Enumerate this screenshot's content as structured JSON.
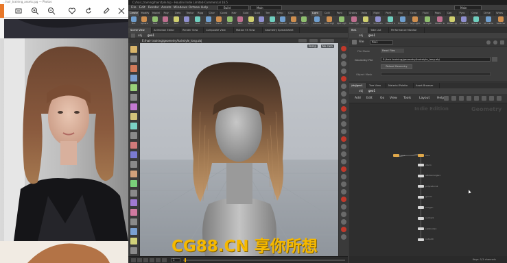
{
  "viewer": {
    "title": "…hair_training_assets.jpg — Photos",
    "toolbar_icons": [
      "tab-icon",
      "fit-icon",
      "zoom-in-icon",
      "zoom-out-icon",
      "favorite-icon",
      "rotate-icon",
      "edit-icon",
      "settings-icon"
    ]
  },
  "houdini": {
    "title": "C:/hair_training/hairstyle.hip - Houdini Indie Limited-Commercial 16.5",
    "menu": [
      "File",
      "Edit",
      "Render",
      "Assets",
      "Windows",
      "Octane",
      "Help"
    ],
    "build_label": "Build",
    "main_label": "Main",
    "main_label_right": "Main",
    "shelf_tabs_left": [
      "Create",
      "Modify",
      "Model",
      "Poly",
      "Defo",
      "Textur",
      "Rigg",
      "Char",
      "Const",
      "Hair",
      "Guid",
      "Guid",
      "Terr",
      "Simp",
      "Clou",
      "Vol"
    ],
    "shelf_tabs_right": [
      "Light",
      "Colli",
      "Parti",
      "Grains",
      "Vella",
      "Rigid",
      "Parti",
      "Visc",
      "Ocea",
      "Fluid",
      "Popu",
      "Con",
      "Pyro",
      "Crow",
      "Drive",
      "Wires"
    ],
    "tools_left": [
      "Box",
      "Sphere",
      "Tube",
      "Torus",
      "Grid",
      "Null",
      "Line",
      "Circle",
      "Curve",
      "Draw",
      "Path",
      "Spray",
      "Font",
      "L-System",
      "Platonic",
      "Metaball",
      "Object"
    ],
    "tools_right": [
      "Camera",
      "Point Light",
      "Spot Light",
      "Area Light",
      "Geometry Light",
      "Volume Light",
      "Distant Light",
      "Environment Light",
      "Sky Light",
      "GI Light",
      "Caustic Light",
      "Portal Light",
      "Ambient",
      "Stereo Cam",
      "VR Camera",
      "Switcher"
    ],
    "viewport_tabs": [
      "Scene View",
      "Animation Editor",
      "Render View",
      "Composite View",
      "Motion FX View",
      "Geometry Spreadsheet"
    ],
    "viewport_path": {
      "obj": "obj",
      "node": "geo1"
    },
    "viewport_label_persp": "Persp",
    "viewport_label_cam": "No cam",
    "viewport_file_path": "E:/hair training/geometry/hairstyle_long.obj",
    "param_tabs": [
      "file1",
      "Take List",
      "Performance Monitor"
    ],
    "param_path": {
      "obj": "obj",
      "node": "geo1"
    },
    "param_node_type": "File",
    "param_node_name": "file1",
    "param_fields": {
      "file_mode_label": "File Mode",
      "file_mode_value": "Read Files",
      "geometry_file_label": "Geometry File",
      "geometry_file_value": "E:/hair training/geometry/hairstyle_long.obj",
      "reload_button": "Reload Geometry",
      "object_mask_label": "Object Mask"
    },
    "net_tabs": [
      "/obj/geo1",
      "Tree View",
      "Material Palette",
      "Asset Browser"
    ],
    "net_path": {
      "obj": "obj",
      "node": "geo1"
    },
    "net_menu": [
      "Add",
      "Edit",
      "Go",
      "View",
      "Tools",
      "Layout",
      "Help"
    ],
    "net_watermark_left": "Indie Edition",
    "net_watermark_right": "Geometry",
    "nodes": [
      "file1",
      "file2",
      "xform",
      "attribwrangle1",
      "polyreduce1",
      "groom",
      "hairgen",
      "normal1",
      "subdivide1",
      "output0"
    ],
    "status_right": "Keys: 1/1 channels",
    "frame_display": "1"
  },
  "watermark": "CG88.CN 享你所想",
  "colors": {
    "accent_orange": "#e8782a",
    "watermark_gold": "#f6b900",
    "node_selected": "#e0a84a"
  }
}
